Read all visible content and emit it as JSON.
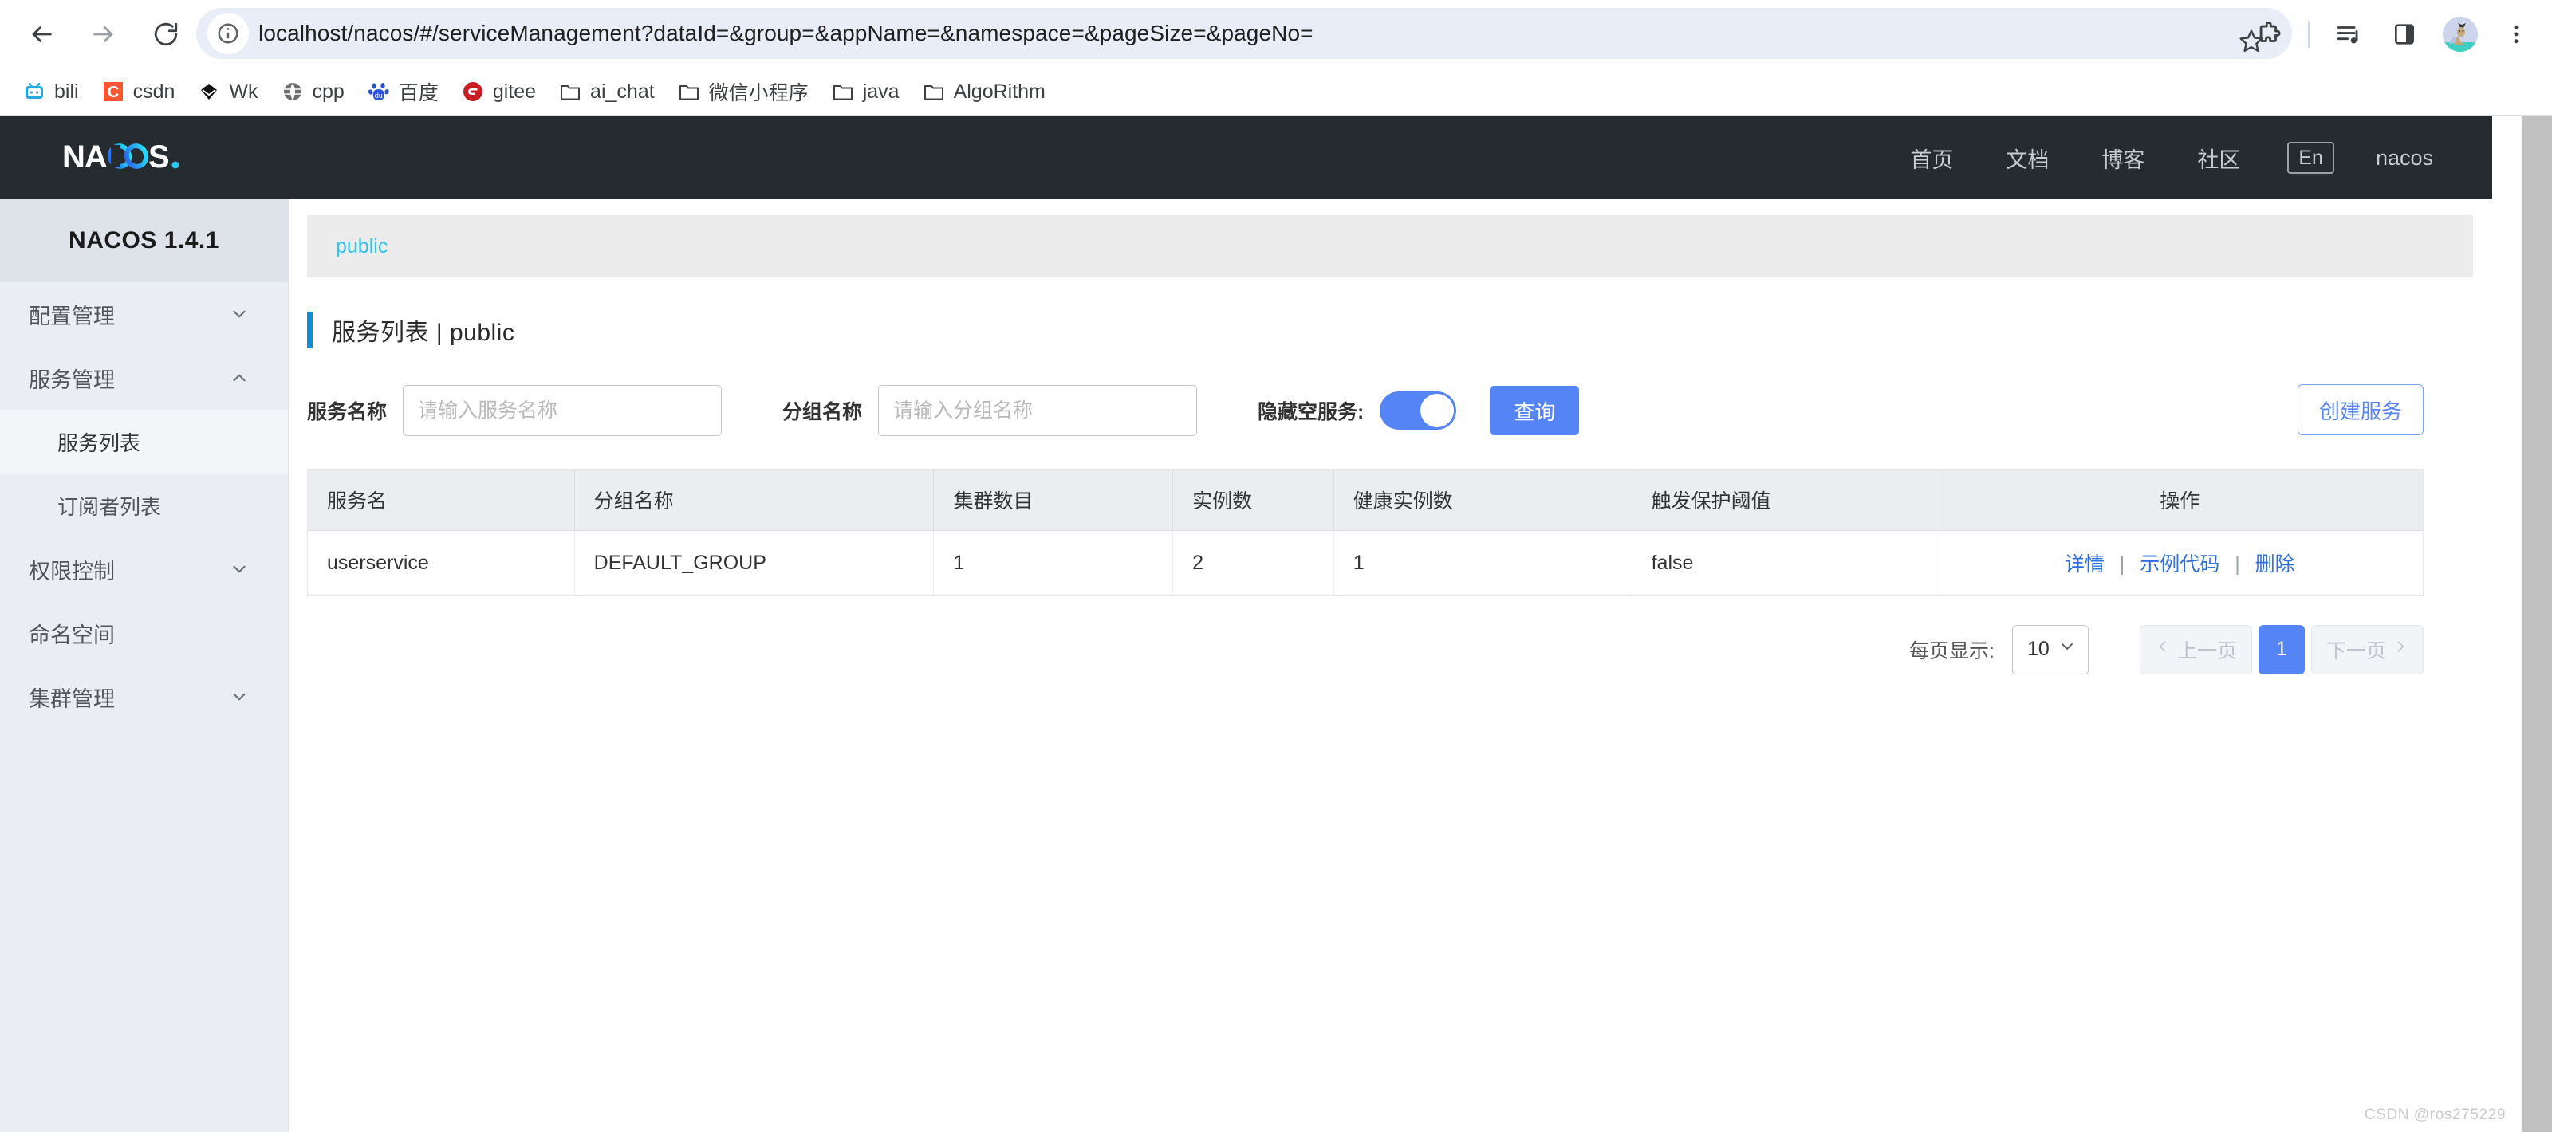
{
  "browser": {
    "url": "localhost/nacos/#/serviceManagement?dataId=&group=&appName=&namespace=&pageSize=&pageNo=",
    "back_icon": "back-arrow-icon",
    "forward_icon": "forward-arrow-icon",
    "reload_icon": "reload-icon",
    "site_info_icon": "site-info-icon",
    "bookmark_star_icon": "bookmark-star-icon",
    "extensions_icon": "extensions-puzzle-icon",
    "media_icon": "media-playlist-icon",
    "sidepanel_icon": "side-panel-icon",
    "profile_icon": "profile-avatar-icon",
    "menu_icon": "three-dot-menu-icon",
    "bookmarks": [
      {
        "label": "bili",
        "icon": "bilibili-icon"
      },
      {
        "label": "csdn",
        "icon": "csdn-icon"
      },
      {
        "label": "Wk",
        "icon": "wk-diamond-icon"
      },
      {
        "label": "cpp",
        "icon": "cpp-globe-icon"
      },
      {
        "label": "百度",
        "icon": "baidu-icon"
      },
      {
        "label": "gitee",
        "icon": "gitee-icon"
      },
      {
        "label": "ai_chat",
        "icon": "folder-icon"
      },
      {
        "label": "微信小程序",
        "icon": "folder-icon"
      },
      {
        "label": "java",
        "icon": "folder-icon"
      },
      {
        "label": "AlgoRithm",
        "icon": "folder-icon"
      }
    ]
  },
  "topnav": {
    "logo_text": "NACOS.",
    "links": [
      "首页",
      "文档",
      "博客",
      "社区"
    ],
    "lang": "En",
    "user": "nacos"
  },
  "sidebar": {
    "title": "NACOS 1.4.1",
    "items": [
      {
        "label": "配置管理",
        "expandable": true,
        "expanded": false,
        "sub": false,
        "active": false
      },
      {
        "label": "服务管理",
        "expandable": true,
        "expanded": true,
        "sub": false,
        "active": false
      },
      {
        "label": "服务列表",
        "expandable": false,
        "expanded": false,
        "sub": true,
        "active": true
      },
      {
        "label": "订阅者列表",
        "expandable": false,
        "expanded": false,
        "sub": true,
        "active": false
      },
      {
        "label": "权限控制",
        "expandable": true,
        "expanded": false,
        "sub": false,
        "active": false
      },
      {
        "label": "命名空间",
        "expandable": false,
        "expanded": false,
        "sub": false,
        "active": false
      },
      {
        "label": "集群管理",
        "expandable": true,
        "expanded": false,
        "sub": false,
        "active": false
      }
    ]
  },
  "main": {
    "breadcrumb": "public",
    "page_title": "服务列表  |  public",
    "filters": {
      "service_label": "服务名称",
      "service_placeholder": "请输入服务名称",
      "service_value": "",
      "group_label": "分组名称",
      "group_placeholder": "请输入分组名称",
      "group_value": "",
      "hide_empty_label": "隐藏空服务:",
      "hide_empty_on": true,
      "query_button": "查询",
      "create_button": "创建服务"
    },
    "table": {
      "columns": [
        "服务名",
        "分组名称",
        "集群数目",
        "实例数",
        "健康实例数",
        "触发保护阈值",
        "操作"
      ],
      "rows": [
        {
          "service": "userservice",
          "group": "DEFAULT_GROUP",
          "clusters": "1",
          "instances": "2",
          "healthy": "1",
          "threshold": "false",
          "actions": [
            "详情",
            "示例代码",
            "删除"
          ],
          "action_sep": "|"
        }
      ]
    },
    "pagination": {
      "per_page_label": "每页显示:",
      "per_page_value": "10",
      "prev_label": "上一页",
      "current_page": "1",
      "next_label": "下一页"
    }
  },
  "watermark": "CSDN @ros275229",
  "colors": {
    "header_bg": "#262b30",
    "sidebar_bg": "#eaedf2",
    "accent_blue": "#5584f7",
    "breadcrumb_link": "#33c1e8",
    "title_bar": "#0c8fd6",
    "action_link": "#2e6fe0"
  }
}
